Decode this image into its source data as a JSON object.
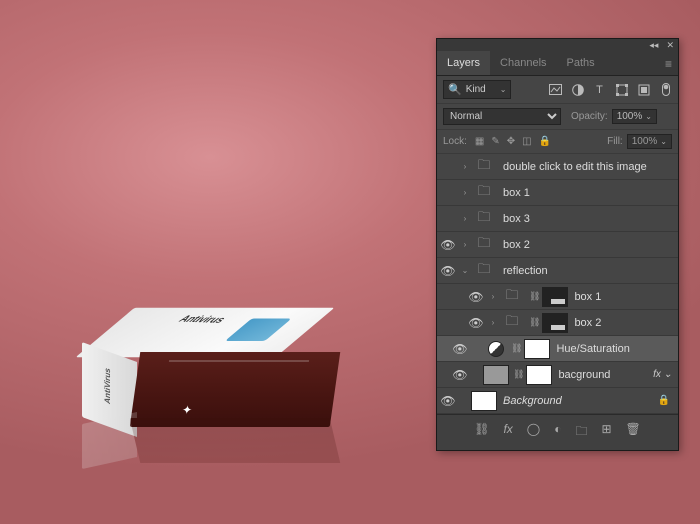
{
  "mockup": {
    "top_text": "Antivirus",
    "side_text": "AntiVirus"
  },
  "panel": {
    "tabs": [
      "Layers",
      "Channels",
      "Paths"
    ],
    "active_tab": 0,
    "search": {
      "placeholder": "",
      "mode": "Kind"
    },
    "blend_mode": "Normal",
    "opacity_label": "Opacity:",
    "opacity_value": "100%",
    "lock_label": "Lock:",
    "fill_label": "Fill:",
    "fill_value": "100%",
    "layers": [
      {
        "vis": false,
        "exp": "›",
        "type": "folder",
        "name": "double click to edit this image",
        "indent": 0
      },
      {
        "vis": false,
        "exp": "›",
        "type": "folder",
        "name": "box 1",
        "indent": 0
      },
      {
        "vis": false,
        "exp": "›",
        "type": "folder",
        "name": "box 3",
        "indent": 0
      },
      {
        "vis": true,
        "exp": "›",
        "type": "folder",
        "name": "box 2",
        "indent": 0
      },
      {
        "vis": true,
        "exp": "⌄",
        "type": "folder",
        "name": "reflection",
        "indent": 0
      },
      {
        "vis": true,
        "exp": "›",
        "type": "group-mask",
        "name": "box 1",
        "indent": 2
      },
      {
        "vis": true,
        "exp": "›",
        "type": "group-mask",
        "name": "box 2",
        "indent": 2
      },
      {
        "vis": true,
        "exp": "",
        "type": "adjust",
        "name": "Hue/Saturation",
        "indent": 1,
        "selected": true
      },
      {
        "vis": true,
        "exp": "",
        "type": "solid-mask",
        "name": "bacground",
        "indent": 1,
        "fx": true
      },
      {
        "vis": true,
        "exp": "",
        "type": "bg",
        "name": "Background",
        "indent": 0,
        "locked": true
      }
    ],
    "bottom_icons": [
      "link",
      "fx",
      "mask",
      "adjust",
      "group",
      "new",
      "trash"
    ]
  }
}
